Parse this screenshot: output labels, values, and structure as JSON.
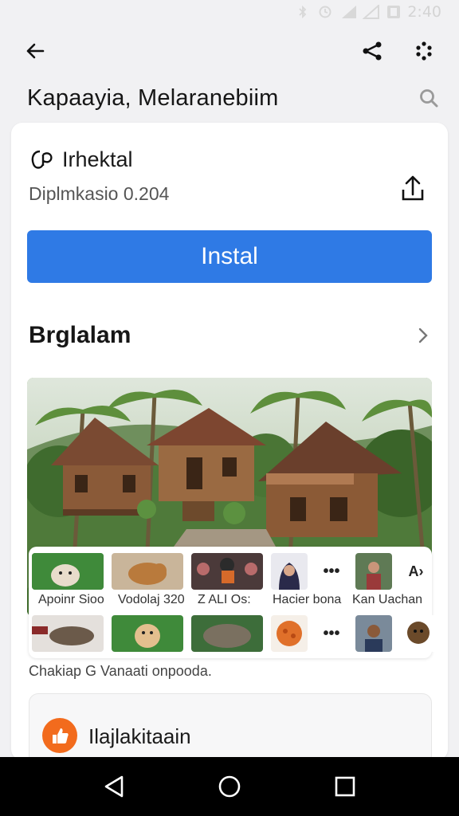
{
  "status_bar": {
    "time": "2:40"
  },
  "header": {
    "title": "Kapaayia, Melaranebiim"
  },
  "app": {
    "name": "Irhektal",
    "subtitle": "Diplmkasio 0.204",
    "install_label": "Instal"
  },
  "section": {
    "title": "Brglalam"
  },
  "thumbnails": {
    "row1_labels": [
      "Apoinr Sioo",
      "Vodolaj 320",
      "Z ALI Os:",
      "Hacier bona",
      "Kan Uachan"
    ],
    "caption": "Chakiap G Vanaati onpooda."
  },
  "bottom": {
    "title": "Ilajlakitaain"
  },
  "colors": {
    "accent": "#2f7ae5",
    "orange": "#f26b1d"
  },
  "icons": [
    "back-arrow-icon",
    "share-icon",
    "more-dots-icon",
    "search-icon",
    "upload-icon",
    "chevron-right-icon",
    "nav-back-icon",
    "nav-home-icon",
    "nav-recents-icon"
  ]
}
